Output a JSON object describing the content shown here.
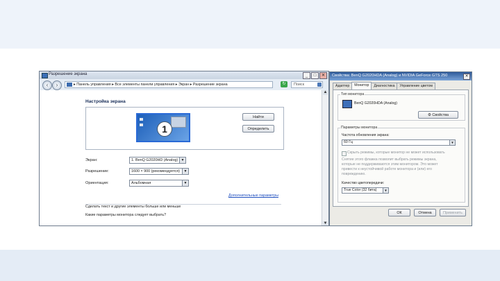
{
  "window": {
    "title": "Разрешение экрана",
    "address": "▸ Панель управления ▸ Все элементы панели управления ▸ Экран ▸ Разрешение экрана",
    "search_placeholder": "Поиск",
    "heading": "Настройка экрана",
    "monitor_number": "1",
    "detect_button": "Найти",
    "identify_button": "Определить",
    "fields": [
      {
        "label": "Экран:",
        "value": "1. BenQ G2020HD (Analog)"
      },
      {
        "label": "Разрешение:",
        "value": "1600 × 900 (рекомендуется)"
      },
      {
        "label": "Ориентация:",
        "value": "Альбомная"
      }
    ],
    "advanced_link": "Дополнительные параметры",
    "bottom_link": "Сделать текст и другие элементы больше или меньше",
    "bottom_text": "Какие параметры монитора следует выбрать?",
    "controls": {
      "minimize": "_",
      "maximize": "□",
      "close": "✕"
    }
  },
  "dialog": {
    "title": "Свойства: BenQ G2020HDA (Analog) и NVIDIA GeForce GTS 250",
    "close": "✕",
    "tabs": [
      "Адаптер",
      "Монитор",
      "Диагностика",
      "Управление цветом"
    ],
    "active_tab": 1,
    "monitor_type_label": "Тип монитора",
    "monitor_name": "BenQ G2020HDA (Analog)",
    "properties_button": "Свойства",
    "monitor_settings_label": "Параметры монитора",
    "refresh_label": "Частота обновления экрана:",
    "refresh_value": "60 Гц",
    "hide_modes_text": "Скрыть режимы, которые монитор не может использовать",
    "hint_lines": [
      "Снятие этого флажка позволит выбрать режимы экрана,",
      "которые не поддерживаются этим монитором. Это может",
      "привести к неустойчивой работе монитора и (или) его",
      "повреждению."
    ],
    "colors_label": "Качество цветопередачи:",
    "colors_value": "True Color (32 бита)",
    "ok": "ОК",
    "cancel": "Отмена",
    "apply": "Применить"
  }
}
